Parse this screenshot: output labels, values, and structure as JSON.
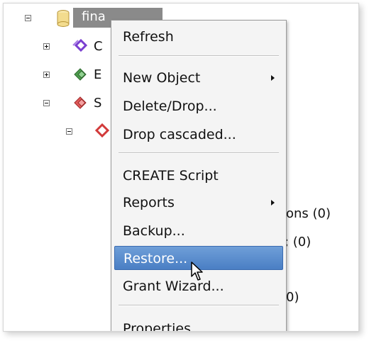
{
  "tree": {
    "root_label": "fina",
    "rows": [
      {
        "partial": "C"
      },
      {
        "partial": "E"
      },
      {
        "partial": "S"
      }
    ],
    "behind_menu": [
      {
        "text": "ons (0)"
      },
      {
        "text": "; (0)"
      },
      {
        "text": "0)"
      }
    ]
  },
  "menu": {
    "items": [
      {
        "label": "Refresh"
      },
      {
        "label": "New Object"
      },
      {
        "label": "Delete/Drop..."
      },
      {
        "label": "Drop cascaded..."
      },
      {
        "label": "CREATE Script"
      },
      {
        "label": "Reports"
      },
      {
        "label": "Backup..."
      },
      {
        "label": "Restore..."
      },
      {
        "label": "Grant Wizard..."
      },
      {
        "label": "Properties..."
      }
    ],
    "highlighted": "Restore..."
  },
  "colors": {
    "selection": "#4a7fc4",
    "tree_selection": "#8a8a8a",
    "menu_bg": "#f4f4f4"
  },
  "icons": {
    "database": "database-icon",
    "catalogs": "catalogs-icon",
    "event_triggers": "event-triggers-icon",
    "schemas": "schemas-icon",
    "schema": "schema-icon"
  }
}
